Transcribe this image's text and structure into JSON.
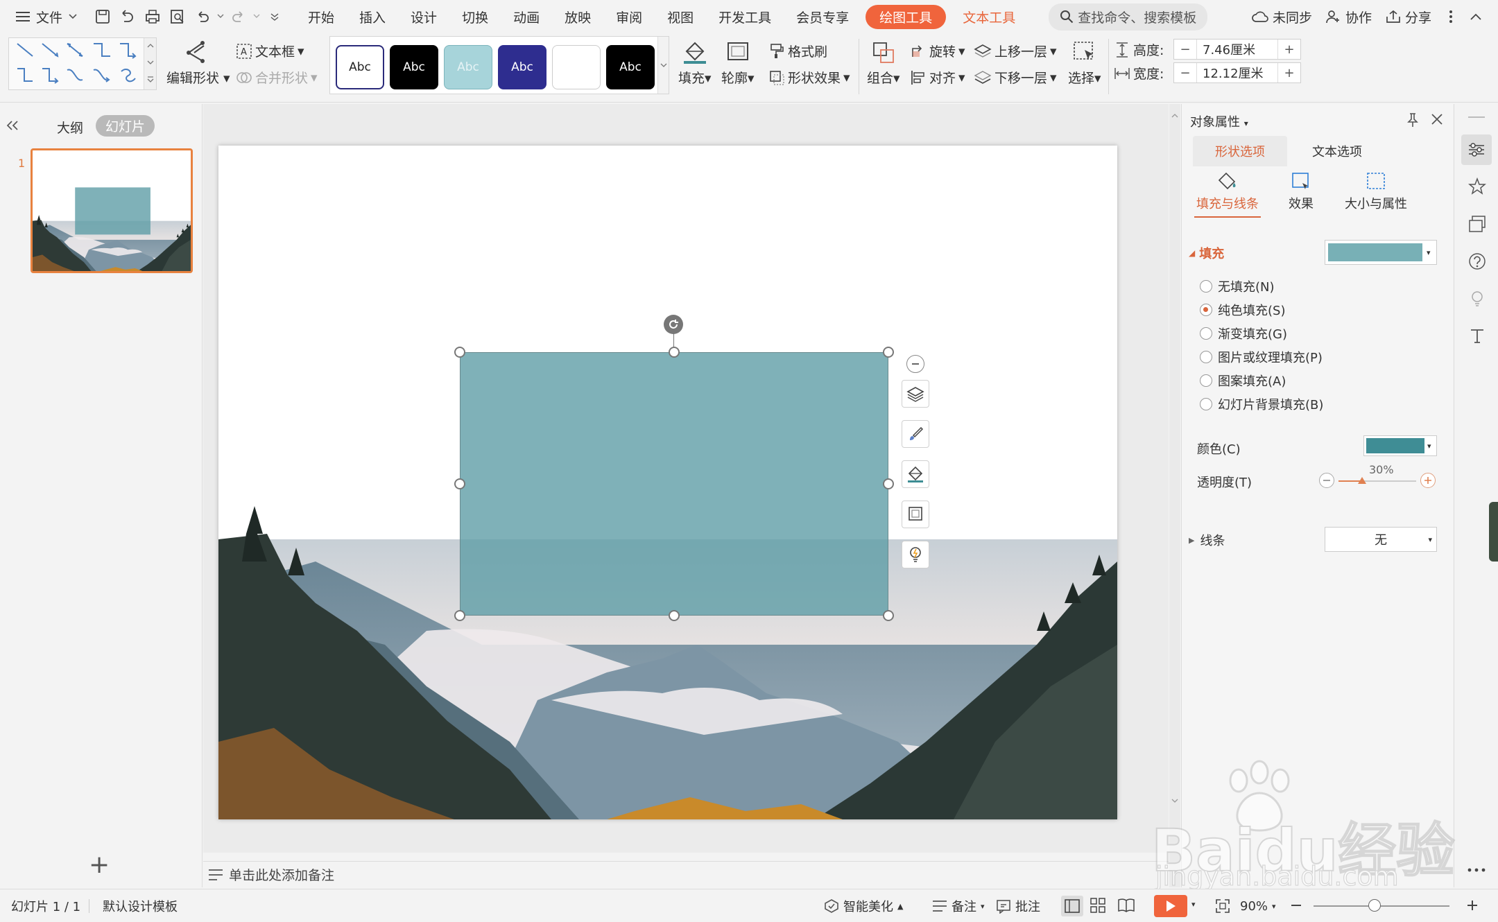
{
  "menubar": {
    "file_label": "文件",
    "items": [
      "开始",
      "插入",
      "设计",
      "切换",
      "动画",
      "放映",
      "审阅",
      "视图",
      "开发工具",
      "会员专享"
    ],
    "active_tool": "绘图工具",
    "text_tool": "文本工具",
    "search_placeholder": "查找命令、搜索模板",
    "unsynced": "未同步",
    "collab": "协作",
    "share": "分享"
  },
  "ribbon": {
    "edit_shape": "编辑形状",
    "text_box": "文本框",
    "merge_shape": "合并形状",
    "style_label": "Abc",
    "fill": "填充",
    "outline": "轮廓",
    "format_painter": "格式刷",
    "shape_effect": "形状效果",
    "group": "组合",
    "rotate": "旋转",
    "align": "对齐",
    "bring_forward": "上移一层",
    "send_backward": "下移一层",
    "select": "选择",
    "height_label": "高度:",
    "height_value": "7.46厘米",
    "width_label": "宽度:",
    "width_value": "12.12厘米",
    "minus": "−",
    "plus": "+"
  },
  "leftpanel": {
    "tab_outline": "大纲",
    "tab_slides": "幻灯片",
    "slide_number": "1",
    "add_symbol": "+"
  },
  "canvas": {
    "notes_placeholder": "单击此处添加备注"
  },
  "rightpanel": {
    "title": "对象属性",
    "tab_shape": "形状选项",
    "tab_text": "文本选项",
    "sub_fill_line": "填充与线条",
    "sub_effect": "效果",
    "sub_size": "大小与属性",
    "fill_section": "填充",
    "options": [
      "无填充(N)",
      "纯色填充(S)",
      "渐变填充(G)",
      "图片或纹理填充(P)",
      "图案填充(A)",
      "幻灯片背景填充(B)"
    ],
    "selected_option": 1,
    "color_label": "颜色(C)",
    "transparency_label": "透明度(T)",
    "transparency_value": "30%",
    "transparency_fraction": 0.3,
    "line_section": "线条",
    "line_value": "无"
  },
  "statusbar": {
    "slide_info": "幻灯片 1 / 1",
    "template": "默认设计模板",
    "beautify": "智能美化",
    "notes": "备注",
    "comments": "批注",
    "zoom": "90%",
    "zoom_fraction": 0.45
  },
  "watermark": {
    "brand": "Baidu经验",
    "url": "jingyan.baidu.com"
  },
  "colors": {
    "accent": "#f0643c",
    "shape_fill": "#5f9ea6",
    "fill_swatch": "#78b0b6",
    "color_swatch": "#3f8d95",
    "orange_text": "#d9653b"
  }
}
